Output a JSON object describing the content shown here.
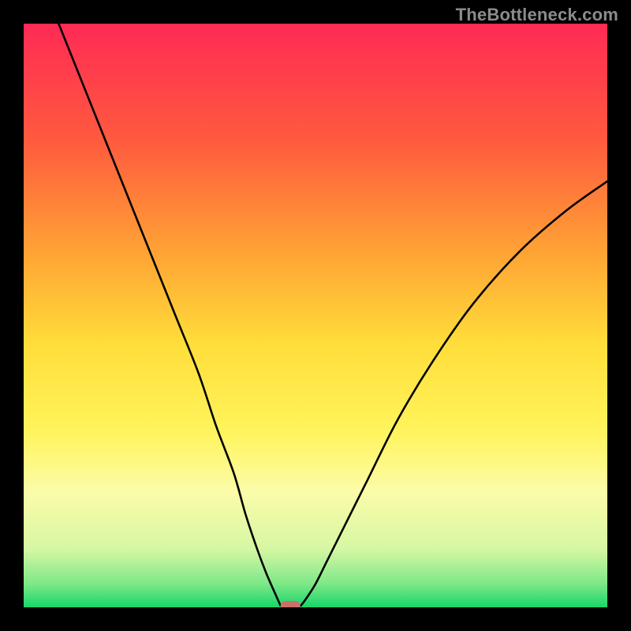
{
  "watermark": "TheBottleneck.com",
  "colors": {
    "black": "#000000",
    "curve": "#000000",
    "marker": "#c97069"
  },
  "chart_data": {
    "type": "line",
    "title": "",
    "xlabel": "",
    "ylabel": "",
    "xlim": [
      0,
      100
    ],
    "ylim": [
      0,
      100
    ],
    "gradient_stops": [
      {
        "offset": 0,
        "color": "#ff2a55"
      },
      {
        "offset": 20,
        "color": "#ff5a3e"
      },
      {
        "offset": 40,
        "color": "#ffa634"
      },
      {
        "offset": 55,
        "color": "#ffde3a"
      },
      {
        "offset": 70,
        "color": "#fff45c"
      },
      {
        "offset": 80,
        "color": "#fcfca8"
      },
      {
        "offset": 90,
        "color": "#d6f7a4"
      },
      {
        "offset": 96,
        "color": "#7de887"
      },
      {
        "offset": 100,
        "color": "#18d66a"
      }
    ],
    "series": [
      {
        "name": "left-branch",
        "x": [
          6,
          10,
          14,
          18,
          22,
          26,
          30,
          33,
          36,
          38,
          40,
          41.5,
          42.8,
          43.6,
          44.0
        ],
        "y": [
          100,
          90,
          80,
          70,
          60,
          50,
          40,
          31,
          23,
          16,
          10,
          6,
          3,
          1.2,
          0.3
        ]
      },
      {
        "name": "right-branch",
        "x": [
          47.5,
          48.4,
          50,
          52,
          55,
          59,
          64,
          70,
          77,
          85,
          93,
          100
        ],
        "y": [
          0.3,
          1.5,
          4,
          8,
          14,
          22,
          32,
          42,
          52,
          61,
          68,
          73
        ]
      }
    ],
    "marker": {
      "x": 45.7,
      "y": 0.3,
      "w": 3.4,
      "h": 1.6,
      "rx": 0.9
    }
  }
}
